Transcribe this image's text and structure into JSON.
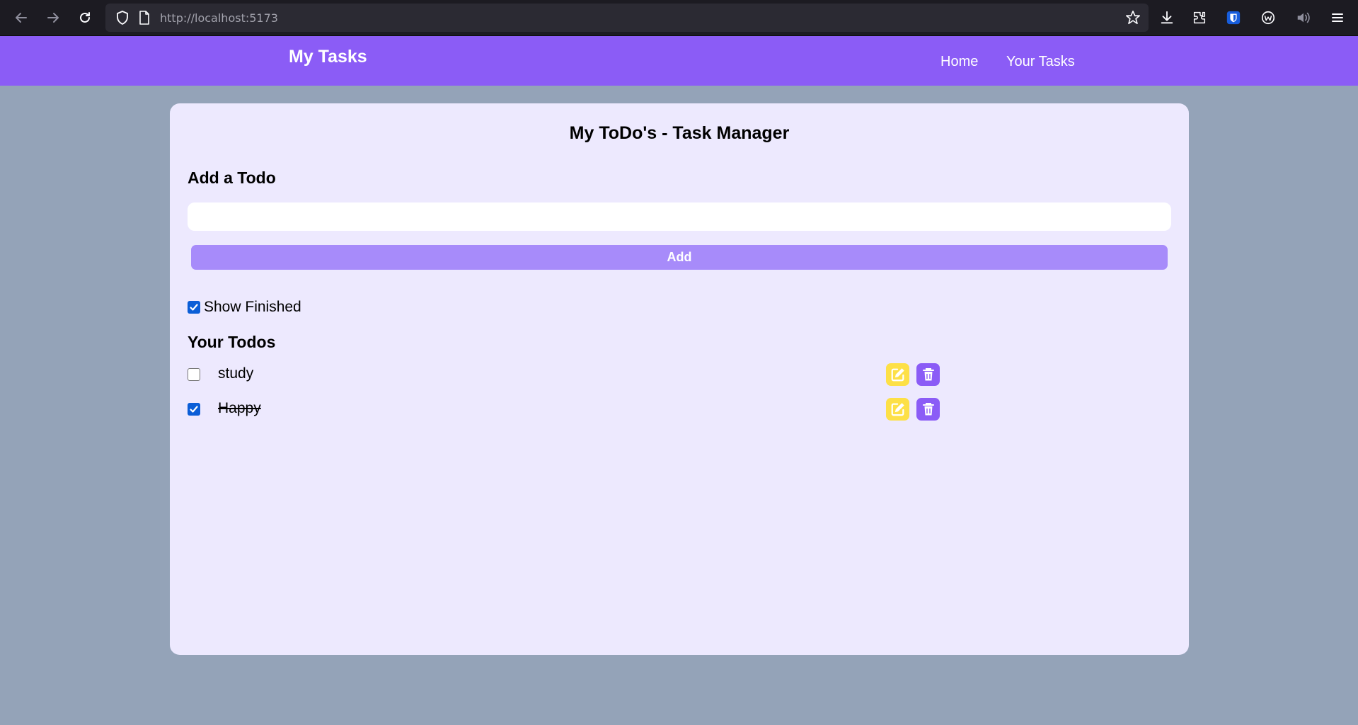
{
  "browser": {
    "url_host": "http://localhost",
    "url_port": ":5173"
  },
  "navbar": {
    "brand": "My Tasks",
    "links": [
      {
        "label": "Home"
      },
      {
        "label": "Your Tasks"
      }
    ],
    "color": "#8b5cf6"
  },
  "main": {
    "title": "My ToDo's - Task Manager",
    "add_section_title": "Add a Todo",
    "input_value": "",
    "add_button_label": "Add",
    "show_finished_label": "Show Finished",
    "show_finished_checked": true,
    "todos_section_title": "Your Todos",
    "todos": [
      {
        "text": "study",
        "completed": false
      },
      {
        "text": "Happy",
        "completed": true
      }
    ]
  },
  "colors": {
    "page_bg": "#94a3b8",
    "card_bg": "#ede9fe",
    "add_button": "#a78bfa",
    "edit_button": "#fde047",
    "delete_button": "#8b5cf6",
    "checkbox_checked": "#0b5ed7"
  },
  "icons": {
    "edit": "edit-pencil-square-icon",
    "delete": "trash-icon"
  }
}
